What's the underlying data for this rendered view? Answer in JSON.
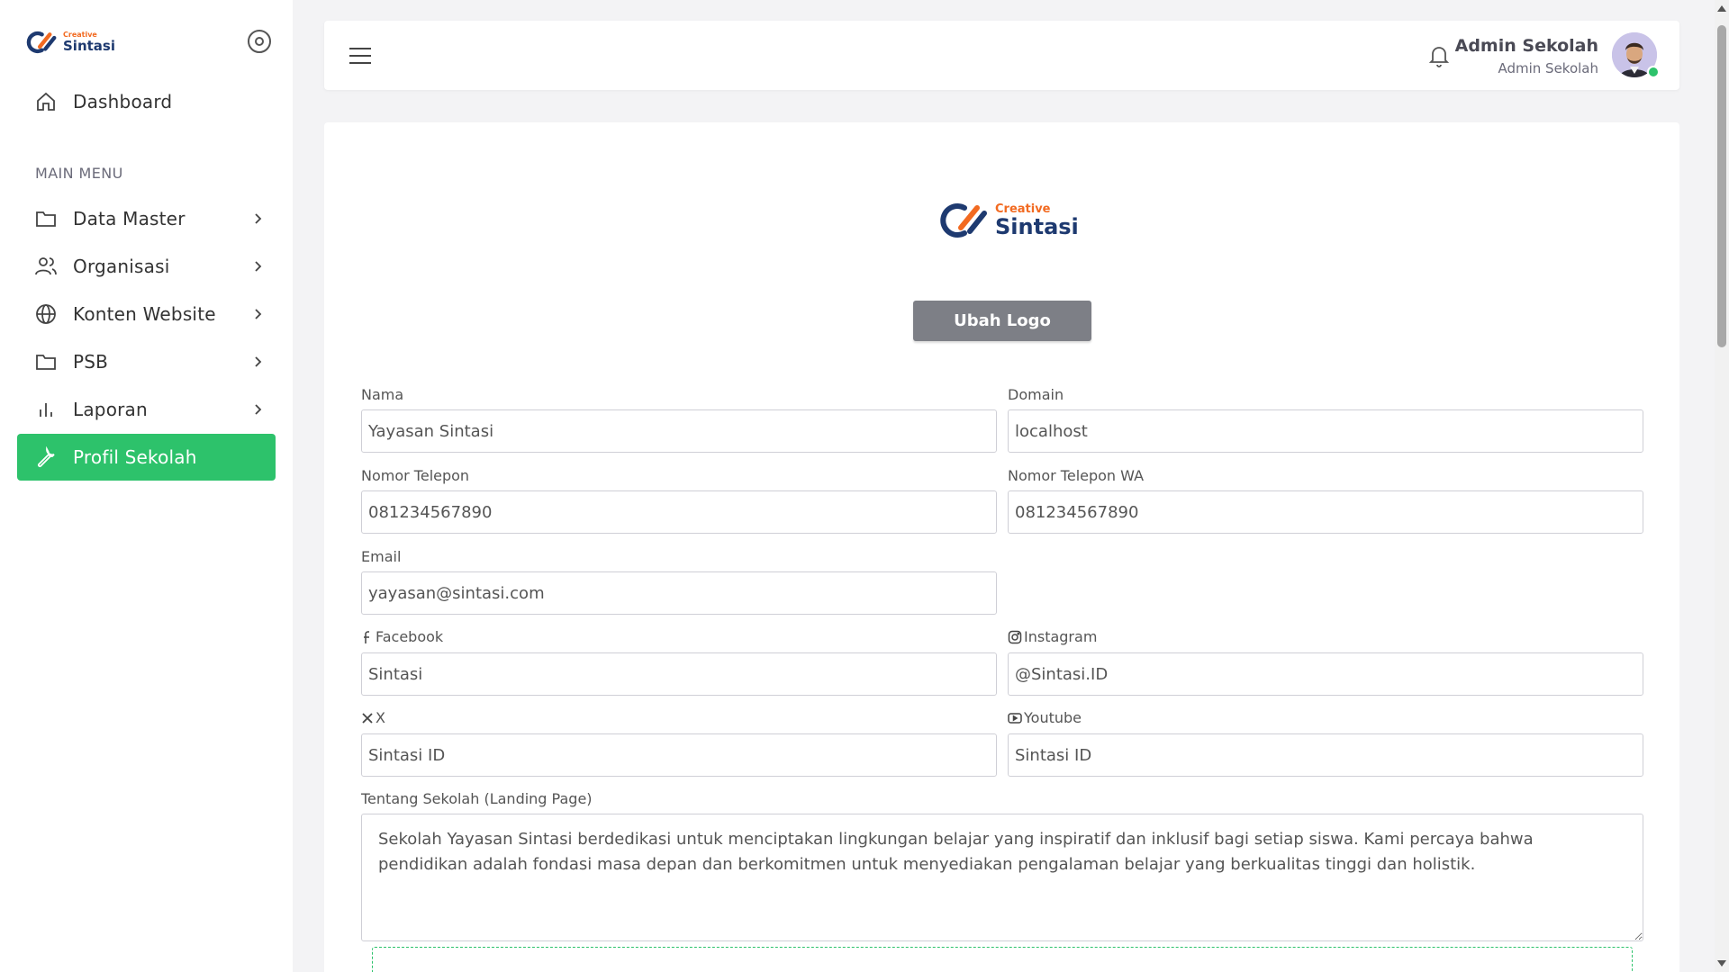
{
  "brand": {
    "small": "Creative",
    "large": "Sintasi",
    "colors": {
      "orange": "#f26a21",
      "navy": "#1e3a70",
      "accent": "#2dc26b"
    }
  },
  "sidebar": {
    "dashboard": {
      "label": "Dashboard",
      "icon": "home-icon"
    },
    "caption": "MAIN MENU",
    "items": [
      {
        "label": "Data Master",
        "icon": "folder-icon",
        "has_children": true
      },
      {
        "label": "Organisasi",
        "icon": "users-icon",
        "has_children": true
      },
      {
        "label": "Konten Website",
        "icon": "globe-icon",
        "has_children": true
      },
      {
        "label": "PSB",
        "icon": "folder-icon",
        "has_children": true
      },
      {
        "label": "Laporan",
        "icon": "bar-chart-icon",
        "has_children": true
      },
      {
        "label": "Profil Sekolah",
        "icon": "wrench-icon",
        "active": true
      }
    ]
  },
  "topbar": {
    "user_name": "Admin Sekolah",
    "user_role": "Admin Sekolah"
  },
  "profile": {
    "change_logo_label": "Ubah Logo",
    "fields": {
      "nama": {
        "label": "Nama",
        "value": "Yayasan Sintasi"
      },
      "domain": {
        "label": "Domain",
        "value": "localhost"
      },
      "telepon": {
        "label": "Nomor Telepon",
        "value": "081234567890"
      },
      "telepon_wa": {
        "label": "Nomor Telepon WA",
        "value": "081234567890"
      },
      "email": {
        "label": "Email",
        "value": "yayasan@sintasi.com"
      },
      "facebook": {
        "label": "Facebook",
        "value": "Sintasi",
        "icon": "facebook-icon"
      },
      "instagram": {
        "label": "Instagram",
        "value": "@Sintasi.ID",
        "icon": "instagram-icon"
      },
      "x": {
        "label": "X",
        "value": "Sintasi ID",
        "icon": "x-icon"
      },
      "youtube": {
        "label": "Youtube",
        "value": "Sintasi ID",
        "icon": "youtube-icon"
      }
    },
    "about": {
      "label": "Tentang Sekolah (Landing Page)",
      "value": "Sekolah Yayasan Sintasi berdedikasi untuk menciptakan lingkungan belajar yang inspiratif dan inklusif bagi setiap siswa. Kami percaya bahwa pendidikan adalah fondasi masa depan dan berkomitmen untuk menyediakan pengalaman belajar yang berkualitas tinggi dan holistik."
    }
  }
}
